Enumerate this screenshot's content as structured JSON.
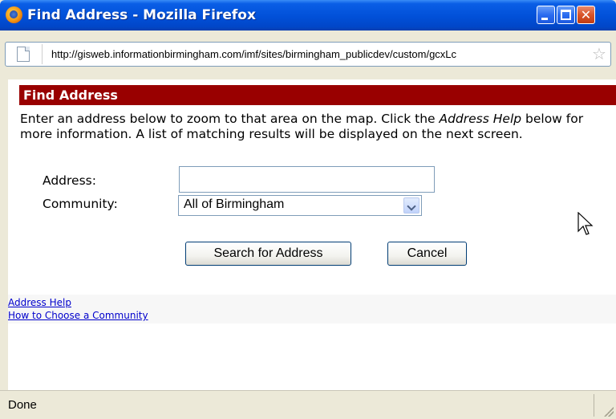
{
  "window": {
    "title": "Find Address - Mozilla Firefox",
    "close_glyph": "✕"
  },
  "urlbar": {
    "url": "http://gisweb.informationbirmingham.com/imf/sites/birmingham_publicdev/custom/gcxLc",
    "star_glyph": "☆"
  },
  "panel": {
    "header": "Find Address",
    "desc_before": "Enter an address below to zoom to that area on the map. Click the ",
    "desc_emphasis": "Address Help",
    "desc_after": " below for more information. A list of matching results will be displayed on the next screen."
  },
  "form": {
    "address_label": "Address:",
    "address_value": "",
    "community_label": "Community:",
    "community_selected": "All of Birmingham"
  },
  "buttons": {
    "search_label": "Search for Address",
    "cancel_label": "Cancel"
  },
  "help": {
    "address_help": "Address Help",
    "choose_community": "How to Choose a Community"
  },
  "status": {
    "text": "Done"
  },
  "colors": {
    "header_bg": "#990000",
    "titlebar": "#0150d8",
    "link": "#0000cc"
  }
}
